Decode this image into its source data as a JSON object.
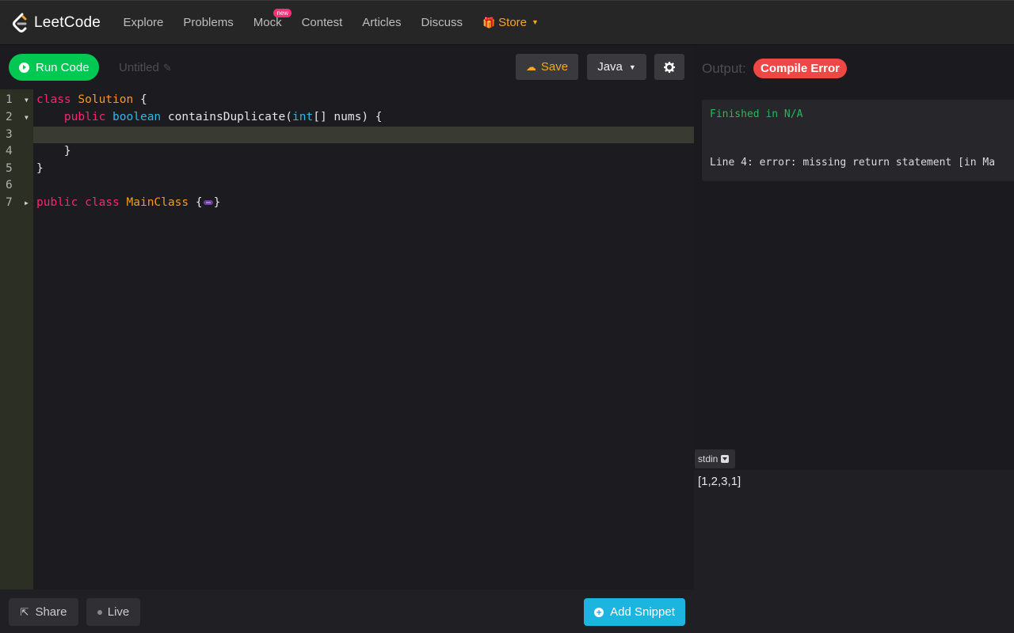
{
  "nav": {
    "logo_text": "LeetCode",
    "items": [
      "Explore",
      "Problems",
      "Mock",
      "Contest",
      "Articles",
      "Discuss"
    ],
    "mock_badge": "new",
    "store_label": "Store"
  },
  "toolbar": {
    "run_label": "Run Code",
    "title": "Untitled",
    "save_label": "Save",
    "language": "Java"
  },
  "editor": {
    "line_numbers": [
      "1",
      "2",
      "3",
      "4",
      "5",
      "6",
      "7"
    ],
    "active_line": 3,
    "lines": [
      "class Solution {",
      "    public boolean containsDuplicate(int[] nums) {",
      "",
      "    }",
      "}",
      "",
      "public class MainClass {}"
    ]
  },
  "bottom": {
    "share_label": "Share",
    "live_label": "Live",
    "snippet_label": "Add Snippet"
  },
  "output": {
    "label": "Output:",
    "status": "Compile Error",
    "finished": "Finished in N/A",
    "error_lines": [
      "Line 4: error: missing return statement [in Ma",
      "    }",
      "    ^"
    ]
  },
  "stdin": {
    "tab_label": "stdin",
    "value": "[1,2,3,1]"
  },
  "colors": {
    "run": "#00c853",
    "save": "#f5a623",
    "compile_error": "#ef4743",
    "snippet": "#1cb5e0",
    "keyword": "#f92672",
    "class_name": "#f79a20",
    "type": "#31b7e4"
  }
}
